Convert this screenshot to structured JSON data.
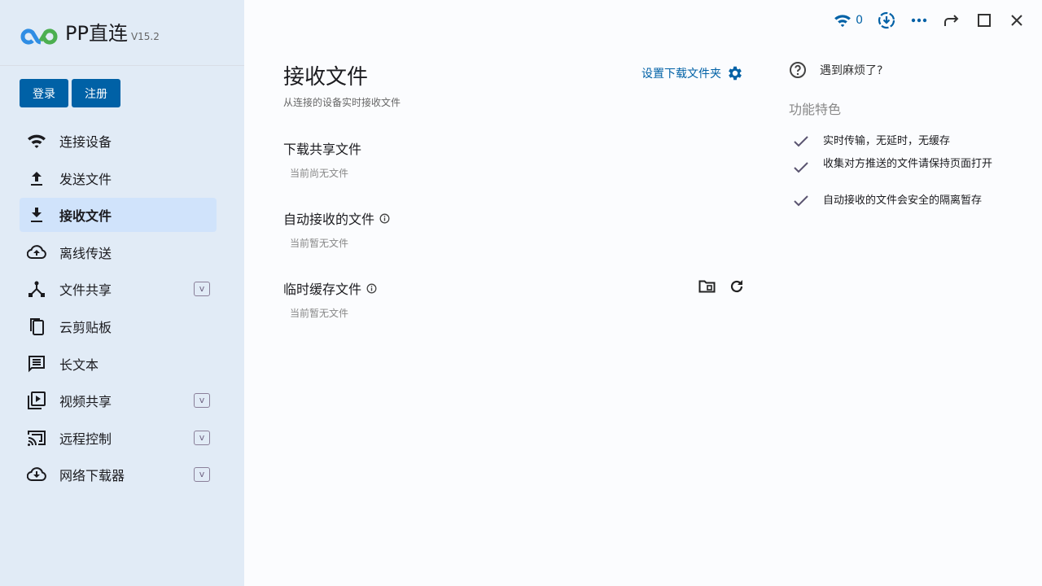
{
  "app": {
    "name": "PP直连",
    "version": "V15.2"
  },
  "auth": {
    "login": "登录",
    "register": "注册"
  },
  "sidebar": {
    "items": [
      {
        "label": "连接设备",
        "icon": "wifi-icon"
      },
      {
        "label": "发送文件",
        "icon": "upload-icon"
      },
      {
        "label": "接收文件",
        "icon": "download-icon",
        "active": true
      },
      {
        "label": "离线传送",
        "icon": "cloud-upload-icon"
      },
      {
        "label": "文件共享",
        "icon": "share-icon",
        "badge": "v"
      },
      {
        "label": "云剪贴板",
        "icon": "copy-icon"
      },
      {
        "label": "长文本",
        "icon": "message-icon"
      },
      {
        "label": "视频共享",
        "icon": "video-library-icon",
        "badge": "v"
      },
      {
        "label": "远程控制",
        "icon": "cast-icon",
        "badge": "v"
      },
      {
        "label": "网络下载器",
        "icon": "cloud-download-icon",
        "badge": "v"
      }
    ]
  },
  "topbar": {
    "connections": "0"
  },
  "page": {
    "title": "接收文件",
    "subtitle": "从连接的设备实时接收文件",
    "set_folder": "设置下载文件夹",
    "sections": [
      {
        "title": "下载共享文件",
        "empty": "当前尚无文件"
      },
      {
        "title": "自动接收的文件",
        "empty": "当前暂无文件"
      },
      {
        "title": "临时缓存文件",
        "empty": "当前暂无文件"
      }
    ]
  },
  "aside": {
    "help": "遇到麻烦了?",
    "features_title": "功能特色",
    "features": [
      "实时传输，无延时，无缓存",
      "收集对方推送的文件请保持页面打开",
      "自动接收的文件会安全的隔离暂存"
    ]
  },
  "colors": {
    "accent": "#0061a6",
    "sidebar": "#e1ebf6",
    "active": "#d0e3fb"
  }
}
